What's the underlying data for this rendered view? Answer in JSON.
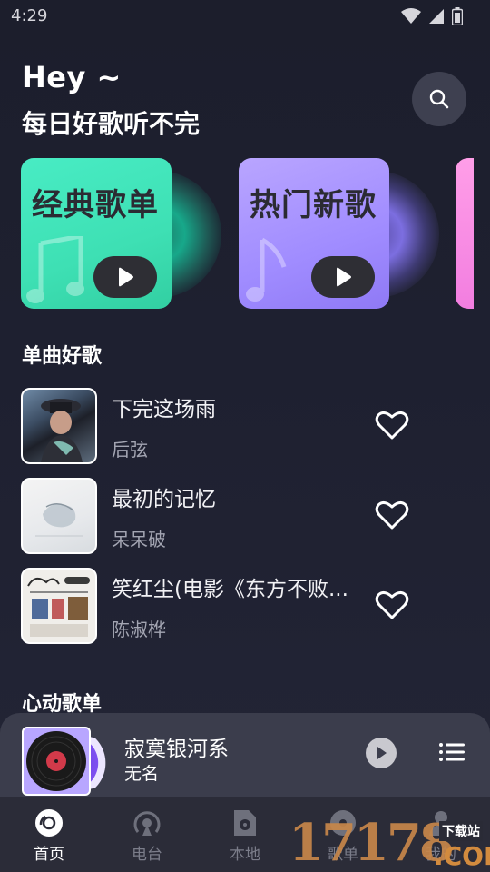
{
  "status_bar": {
    "time": "4:29"
  },
  "header": {
    "greeting": "Hey ~",
    "tagline": "每日好歌听不完"
  },
  "feature_cards": [
    {
      "title": "经典歌单",
      "accent": "#3ee0b4"
    },
    {
      "title": "热门新歌",
      "accent": "#a08cff"
    },
    {
      "title": "",
      "accent": "#ff9ee8"
    }
  ],
  "sections": {
    "singles": "单曲好歌",
    "playlists": "心动歌单"
  },
  "songs": [
    {
      "title": "下完这场雨",
      "artist": "后弦"
    },
    {
      "title": "最初的记忆",
      "artist": "呆呆破"
    },
    {
      "title": "笑红尘(电影《东方不败...",
      "artist": "陈淑桦"
    }
  ],
  "now_playing": {
    "title": "寂寞银河系",
    "artist": "无名"
  },
  "nav": {
    "items": [
      {
        "label": "首页",
        "icon": "home-disc-icon",
        "active": true
      },
      {
        "label": "电台",
        "icon": "radio-icon",
        "active": false
      },
      {
        "label": "本地",
        "icon": "local-file-icon",
        "active": false
      },
      {
        "label": "歌单",
        "icon": "playlist-icon",
        "active": false
      },
      {
        "label": "我的",
        "icon": "profile-icon",
        "active": false
      }
    ]
  },
  "watermark": {
    "number": "17178",
    "caption": "下载站",
    "domain": ".COM"
  }
}
